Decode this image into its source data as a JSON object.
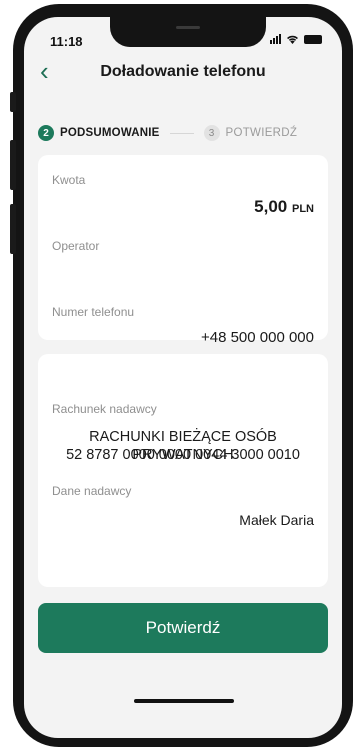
{
  "status": {
    "time": "11:18"
  },
  "header": {
    "title": "Doładowanie telefonu"
  },
  "steps": [
    {
      "number": "2",
      "label": "PODSUMOWANIE",
      "active": true
    },
    {
      "number": "3",
      "label": "POTWIERDŹ",
      "active": false
    }
  ],
  "summary": {
    "amount_label": "Kwota",
    "amount_value": "5,00",
    "amount_currency": "PLN",
    "operator_label": "Operator",
    "operator_value": "",
    "phone_label": "Numer telefonu",
    "phone_value": "+48 500 000 000"
  },
  "sender": {
    "account_label": "Rachunek nadawcy",
    "account_name": "RACHUNKI BIEŻĄCE OSÓB PRYWATNYCH",
    "account_number": "52 8787 0000 0000 0044 3000 0010",
    "data_label": "Dane nadawcy",
    "data_value": "Małek Daria"
  },
  "actions": {
    "confirm_label": "Potwierdź"
  },
  "colors": {
    "accent": "#1d7a5c",
    "background": "#f3f3f3"
  }
}
